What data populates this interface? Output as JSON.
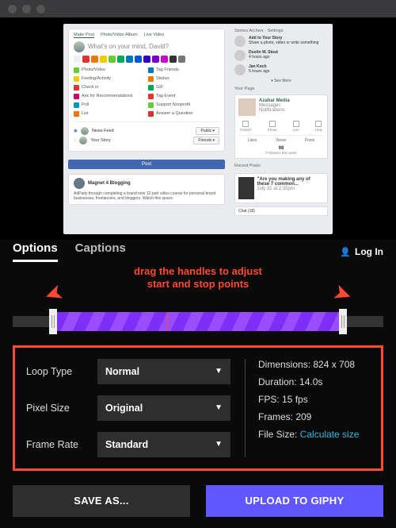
{
  "preview": {
    "composer_tabs": [
      "Make Post",
      "Photo/Video Album",
      "Live Video"
    ],
    "prompt": "What's on your mind, David?",
    "colors": [
      "#f0f0f0",
      "#d33",
      "#e70",
      "#ec0",
      "#6c3",
      "#0a5",
      "#07b",
      "#05d",
      "#30c",
      "#70c",
      "#c0c",
      "#333",
      "#777"
    ],
    "grid": [
      {
        "color": "#6c3",
        "t": "Photo/Video"
      },
      {
        "color": "#07b",
        "t": "Tag Friends"
      },
      {
        "color": "#ec0",
        "t": "Feeling/Activity"
      },
      {
        "color": "#e70",
        "t": "Sticker"
      },
      {
        "color": "#d33",
        "t": "Check in"
      },
      {
        "color": "#0a5",
        "t": "GIF"
      },
      {
        "color": "#c06",
        "t": "Ask for Recommendations"
      },
      {
        "color": "#e33",
        "t": "Tag Event"
      },
      {
        "color": "#09b",
        "t": "Poll"
      },
      {
        "color": "#6c3",
        "t": "Support Nonprofit"
      },
      {
        "color": "#e70",
        "t": "List"
      },
      {
        "color": "#d33",
        "t": "Answer a Question"
      }
    ],
    "audience": [
      {
        "selected": true,
        "t": "News Feed",
        "btn": "Public ▾"
      },
      {
        "selected": false,
        "t": "Your Story",
        "btn": "Friends ▾"
      }
    ],
    "post_btn": "Post",
    "feed_author": "Magnet 4 Blogging",
    "feed_text": "AdPady through completing a brand new 12-part video course for personal brand businesses, freelancers, and bloggers. Watch this space.",
    "right": {
      "stories_head": "Stories          Archive · Settings",
      "stories": [
        {
          "t": "Add to Your Story",
          "s": "Share a photo, video or write something"
        },
        {
          "t": "Dustin W. Stout",
          "s": "4 hours ago"
        },
        {
          "t": "Jan Koch",
          "s": "5 hours ago"
        }
      ],
      "see_more": "▾ See More",
      "page_head": "Your Page",
      "page_name": "Azahar Media",
      "page_sub1": "Messages",
      "page_sub2": "Notifications",
      "icons": [
        "Publish",
        "Photo",
        "Live",
        "Help"
      ],
      "tabs": [
        "Likes",
        "Views",
        "Posts"
      ],
      "stats": "98",
      "stats_sub": "Followers this week",
      "promo_head": "Recent Posts",
      "promo_t": "\"Are you making any of these 7 common...",
      "promo_s": "July 31 at 2:35pm",
      "chat": "Chat (18)"
    }
  },
  "tabs": {
    "options": "Options",
    "captions": "Captions"
  },
  "login": "Log In",
  "annotation": {
    "l1": "drag the handles to adjust",
    "l2": "start and stop points"
  },
  "controls": {
    "loop_label": "Loop Type",
    "loop_val": "Normal",
    "pixel_label": "Pixel Size",
    "pixel_val": "Original",
    "frame_label": "Frame Rate",
    "frame_val": "Standard"
  },
  "info": {
    "dim": "Dimensions: 824 x 708",
    "dur": "Duration: 14.0s",
    "fps": "FPS: 15 fps",
    "frames": "Frames: 209",
    "size_label": "File Size: ",
    "size_link": "Calculate size"
  },
  "buttons": {
    "save": "SAVE AS...",
    "upload": "UPLOAD TO GIPHY"
  }
}
